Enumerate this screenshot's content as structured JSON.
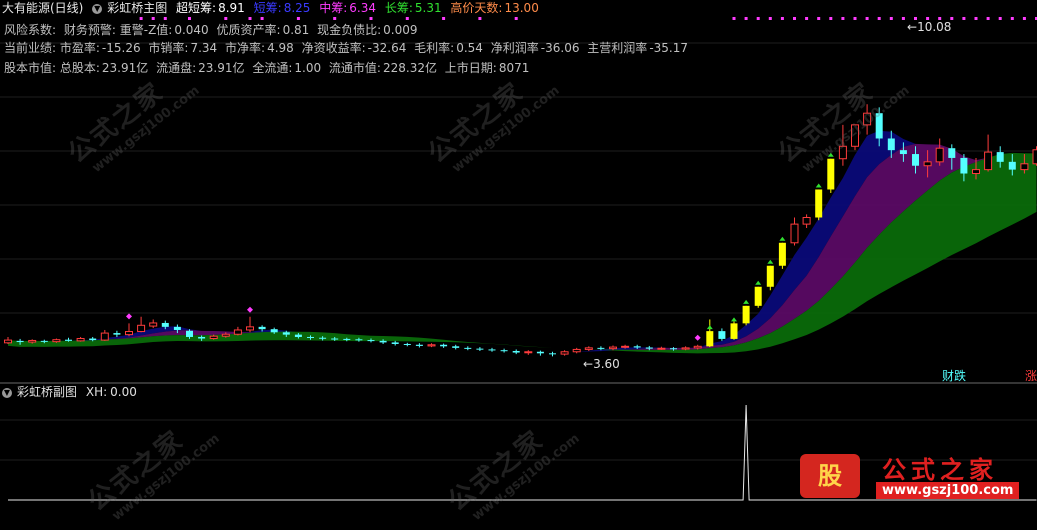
{
  "main_header": {
    "stock_name": "大有能源(日线)",
    "indicator_name": "彩虹桥主图",
    "values": [
      {
        "label": "超短筹:",
        "value": "8.91",
        "label_color": "#ffffff",
        "value_color": "#ffffff"
      },
      {
        "label": "短筹:",
        "value": "8.25",
        "label_color": "#3a3aff",
        "value_color": "#3a3aff"
      },
      {
        "label": "中筹:",
        "value": "6.34",
        "label_color": "#ff3cff",
        "value_color": "#ff3cff"
      },
      {
        "label": "长筹:",
        "value": "5.31",
        "label_color": "#30e030",
        "value_color": "#30e030"
      },
      {
        "label": "高价天数:",
        "value": "13.00",
        "label_color": "#ff8c4a",
        "value_color": "#ff8c4a"
      }
    ]
  },
  "info_lines": {
    "line1": [
      {
        "label": "风险系数:",
        "value": ""
      },
      {
        "label": "财务预警: 重警-Z值:",
        "value": "0.040"
      },
      {
        "label": "优质资产率:",
        "value": "0.81"
      },
      {
        "label": "现金负债比:",
        "value": "0.009"
      }
    ],
    "line2": [
      {
        "label": "当前业绩: 市盈率:",
        "value": "-15.26"
      },
      {
        "label": "市销率:",
        "value": "7.34"
      },
      {
        "label": "市净率:",
        "value": "4.98"
      },
      {
        "label": "净资收益率:",
        "value": "-32.64"
      },
      {
        "label": "毛利率:",
        "value": "0.54"
      },
      {
        "label": "净利润率",
        "value": "-36.06"
      },
      {
        "label": "主营利润率",
        "value": "-35.17"
      }
    ],
    "line3": [
      {
        "label": "股本市值: 总股本:",
        "value": "23.91亿"
      },
      {
        "label": "流通盘:",
        "value": "23.91亿"
      },
      {
        "label": "全流通:",
        "value": "1.00"
      },
      {
        "label": "流通市值:",
        "value": "228.32亿"
      },
      {
        "label": "上市日期:",
        "value": "8071"
      }
    ]
  },
  "chart_annotations": {
    "high_price_label": "10.08",
    "low_price_label": "3.60",
    "bottom_tag_left": "财跌",
    "bottom_tag_right": "涨"
  },
  "sub_header": {
    "indicator_name": "彩虹桥副图",
    "value_label": "XH:",
    "value": "0.00"
  },
  "watermarks": {
    "text": "公式之家",
    "url": "www.gszj100.com"
  },
  "logo": {
    "badge": "股",
    "name": "公式之家",
    "url": "www.gszj100.com"
  },
  "colors": {
    "up_candle": "#ff3c3c",
    "down_candle": "#54ffff",
    "limit_up_candle": "#ffff00",
    "band_blue": "#0a0a78",
    "band_purple": "#5a0a64",
    "band_green": "#0a6a0a",
    "signal_dot": "#ff3cff"
  },
  "chart_data": {
    "type": "candlestick",
    "series": [
      {
        "name": "K",
        "values": [
          [
            3.95,
            4.02,
            4.1,
            3.92
          ],
          [
            4.0,
            3.97,
            4.05,
            3.9
          ],
          [
            3.97,
            4.01,
            4.04,
            3.93
          ],
          [
            4.0,
            3.98,
            4.03,
            3.94
          ],
          [
            3.98,
            4.03,
            4.06,
            3.95
          ],
          [
            4.03,
            4.0,
            4.08,
            3.98
          ],
          [
            4.0,
            4.06,
            4.1,
            3.98
          ],
          [
            4.06,
            4.02,
            4.1,
            3.99
          ],
          [
            4.02,
            4.2,
            4.28,
            4.0
          ],
          [
            4.2,
            4.16,
            4.26,
            4.1
          ],
          [
            4.16,
            4.24,
            4.45,
            4.12
          ],
          [
            4.24,
            4.4,
            4.62,
            4.22
          ],
          [
            4.38,
            4.46,
            4.55,
            4.33
          ],
          [
            4.46,
            4.36,
            4.52,
            4.3
          ],
          [
            4.36,
            4.28,
            4.42,
            4.2
          ],
          [
            4.26,
            4.1,
            4.3,
            4.05
          ],
          [
            4.1,
            4.06,
            4.14,
            4.0
          ],
          [
            4.06,
            4.12,
            4.16,
            4.03
          ],
          [
            4.12,
            4.17,
            4.22,
            4.08
          ],
          [
            4.17,
            4.28,
            4.36,
            4.14
          ],
          [
            4.28,
            4.36,
            4.62,
            4.22
          ],
          [
            4.36,
            4.3,
            4.4,
            4.24
          ],
          [
            4.3,
            4.22,
            4.34,
            4.18
          ],
          [
            4.22,
            4.16,
            4.26,
            4.1
          ],
          [
            4.16,
            4.1,
            4.2,
            4.06
          ],
          [
            4.1,
            4.08,
            4.14,
            4.03
          ],
          [
            4.08,
            4.06,
            4.12,
            4.01
          ],
          [
            4.06,
            4.05,
            4.1,
            4.0
          ],
          [
            4.05,
            4.04,
            4.08,
            3.99
          ],
          [
            4.04,
            4.02,
            4.08,
            3.98
          ],
          [
            4.02,
            4.0,
            4.06,
            3.96
          ],
          [
            4.0,
            3.96,
            4.04,
            3.92
          ],
          [
            3.96,
            3.92,
            4.0,
            3.88
          ],
          [
            3.92,
            3.9,
            3.95,
            3.86
          ],
          [
            3.9,
            3.87,
            3.94,
            3.83
          ],
          [
            3.87,
            3.9,
            3.94,
            3.84
          ],
          [
            3.9,
            3.86,
            3.93,
            3.82
          ],
          [
            3.86,
            3.82,
            3.9,
            3.78
          ],
          [
            3.82,
            3.8,
            3.86,
            3.76
          ],
          [
            3.8,
            3.78,
            3.84,
            3.74
          ],
          [
            3.78,
            3.76,
            3.82,
            3.72
          ],
          [
            3.76,
            3.74,
            3.8,
            3.7
          ],
          [
            3.74,
            3.7,
            3.78,
            3.66
          ],
          [
            3.7,
            3.72,
            3.76,
            3.64
          ],
          [
            3.72,
            3.68,
            3.75,
            3.62
          ],
          [
            3.68,
            3.66,
            3.72,
            3.6
          ],
          [
            3.66,
            3.72,
            3.76,
            3.62
          ],
          [
            3.72,
            3.78,
            3.82,
            3.68
          ],
          [
            3.78,
            3.82,
            3.86,
            3.74
          ],
          [
            3.82,
            3.8,
            3.86,
            3.76
          ],
          [
            3.8,
            3.84,
            3.88,
            3.76
          ],
          [
            3.84,
            3.86,
            3.9,
            3.8
          ],
          [
            3.86,
            3.83,
            3.9,
            3.79
          ],
          [
            3.83,
            3.8,
            3.87,
            3.76
          ],
          [
            3.8,
            3.81,
            3.85,
            3.77
          ],
          [
            3.81,
            3.79,
            3.84,
            3.75
          ],
          [
            3.79,
            3.82,
            3.86,
            3.76
          ],
          [
            3.82,
            3.86,
            3.9,
            3.78
          ],
          [
            3.86,
            4.25,
            4.55,
            3.84
          ],
          [
            4.25,
            4.05,
            4.32,
            4.0
          ],
          [
            4.05,
            4.45,
            4.5,
            4.03
          ],
          [
            4.45,
            4.9,
            4.9,
            4.4
          ],
          [
            4.9,
            5.39,
            5.39,
            4.85
          ],
          [
            5.39,
            5.93,
            5.93,
            5.3
          ],
          [
            5.93,
            6.52,
            6.52,
            5.85
          ],
          [
            6.52,
            7.0,
            7.17,
            6.45
          ],
          [
            7.0,
            7.17,
            7.25,
            6.9
          ],
          [
            7.17,
            7.89,
            7.89,
            7.1
          ],
          [
            7.89,
            8.68,
            8.68,
            7.8
          ],
          [
            8.68,
            9.0,
            9.55,
            8.5
          ],
          [
            9.0,
            9.55,
            9.55,
            8.9
          ],
          [
            9.55,
            9.85,
            10.08,
            9.3
          ],
          [
            9.85,
            9.2,
            10.0,
            9.0
          ],
          [
            9.2,
            8.9,
            9.4,
            8.7
          ],
          [
            8.9,
            8.8,
            9.1,
            8.6
          ],
          [
            8.8,
            8.5,
            9.0,
            8.3
          ],
          [
            8.5,
            8.6,
            8.9,
            8.2
          ],
          [
            8.6,
            8.95,
            9.2,
            8.5
          ],
          [
            8.95,
            8.7,
            9.05,
            8.4
          ],
          [
            8.7,
            8.3,
            8.8,
            8.1
          ],
          [
            8.3,
            8.4,
            8.7,
            8.15
          ],
          [
            8.4,
            8.85,
            9.3,
            8.35
          ],
          [
            8.85,
            8.6,
            9.0,
            8.45
          ],
          [
            8.6,
            8.4,
            8.8,
            8.25
          ],
          [
            8.4,
            8.55,
            8.8,
            8.3
          ],
          [
            8.55,
            8.91,
            9.0,
            8.5
          ]
        ]
      }
    ],
    "ylim": [
      3.2,
      10.6
    ],
    "grid": true,
    "sub_chart": {
      "name": "XH",
      "values": [
        0,
        0,
        0,
        0,
        0,
        0,
        0,
        0,
        0,
        0,
        0,
        0,
        0,
        0,
        0,
        0,
        0,
        0,
        0,
        0,
        0,
        0,
        0,
        0,
        0,
        0,
        0,
        0,
        0,
        0,
        0,
        0,
        0,
        0,
        0,
        0,
        0,
        0,
        0,
        0,
        0,
        0,
        0,
        0,
        0,
        0,
        0,
        0,
        0,
        0,
        0,
        0,
        0,
        0,
        0,
        0,
        0,
        0,
        0,
        0,
        0,
        1,
        0,
        0,
        0,
        0,
        0,
        0,
        0,
        0,
        0,
        0,
        0,
        0,
        0,
        0,
        0,
        0,
        0,
        0,
        0,
        0,
        0,
        0,
        0,
        0
      ]
    }
  }
}
